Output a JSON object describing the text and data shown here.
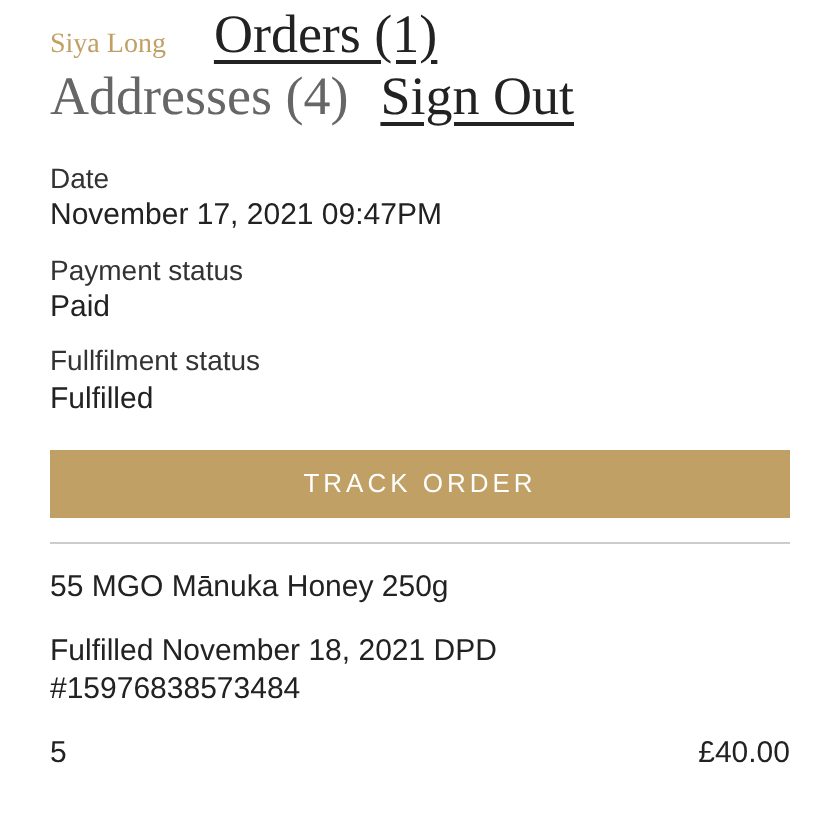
{
  "account_nav": {
    "customer_name": "Siya Long",
    "links": [
      {
        "label": "Orders (1)",
        "selected": true
      },
      {
        "label": "Addresses (4)",
        "selected": false
      },
      {
        "label": "Sign Out",
        "selected": true
      }
    ]
  },
  "order_details": [
    {
      "label": "Date",
      "value": "November 17, 2021 09:47PM"
    },
    {
      "label": "Payment status",
      "value": "Paid"
    },
    {
      "label": "Fullfilment status",
      "value": "Fulfilled"
    }
  ],
  "track_button": "TRACK ORDER",
  "line_item": {
    "product": "55 MGO Mānuka Honey 250g",
    "fulfillment": "Fulfilled November 18, 2021 DPD",
    "tracking_number": "#15976838573484",
    "quantity": "5",
    "price": "£40.00"
  }
}
